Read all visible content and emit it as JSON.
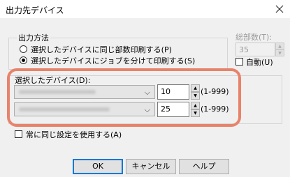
{
  "dialog": {
    "title": "出力先デバイス"
  },
  "output_method": {
    "legend": "出力方法",
    "options": [
      {
        "label": "選択したデバイスに同じ部数印刷する(P)",
        "selected": false
      },
      {
        "label": "選択したデバイスにジョブを分けて印刷する(S)",
        "selected": true
      }
    ]
  },
  "total_copies": {
    "label": "総部数(T):",
    "value": "35",
    "auto_label": "自動(U)",
    "auto_checked": false
  },
  "devices": {
    "label": "選択したデバイス(D):",
    "rows": [
      {
        "copies": "10",
        "range": "(1-999)"
      },
      {
        "copies": "25",
        "range": "(1-999)"
      }
    ]
  },
  "always_same": {
    "label": "常に同じ設定を使用する(A)",
    "checked": false
  },
  "buttons": {
    "ok": "OK",
    "cancel": "キャンセル",
    "help": "ヘルプ"
  },
  "colors": {
    "highlight": "#e8836b",
    "accent": "#0078d7"
  }
}
